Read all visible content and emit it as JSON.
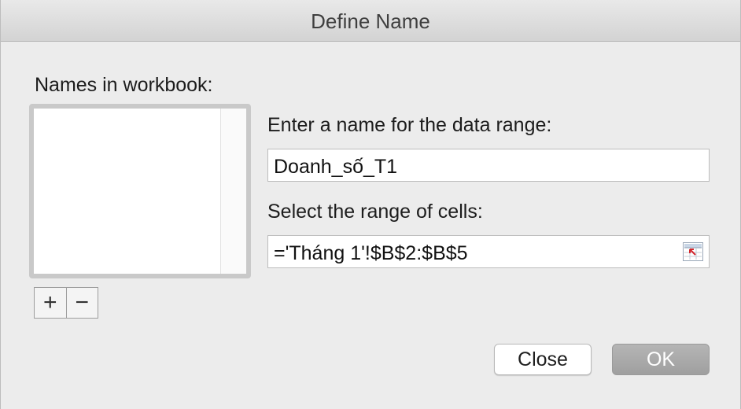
{
  "window": {
    "title": "Define Name"
  },
  "names_panel": {
    "label": "Names in workbook:",
    "items": [],
    "add_label": "+",
    "remove_label": "−"
  },
  "name_field": {
    "label": "Enter a name for the data range:",
    "value": "Doanh_số_T1"
  },
  "range_field": {
    "label": "Select the range of cells:",
    "value": "='Tháng 1'!$B$2:$B$5",
    "picker_icon": "range-select-icon"
  },
  "buttons": {
    "close_label": "Close",
    "ok_label": "OK"
  }
}
